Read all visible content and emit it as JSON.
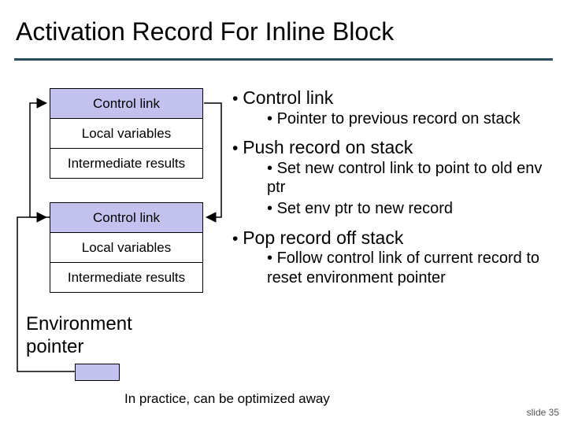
{
  "title": "Activation Record For Inline Block",
  "diagram": {
    "record1": {
      "control": "Control link",
      "locals": "Local variables",
      "inter": "Intermediate results"
    },
    "record2": {
      "control": "Control link",
      "locals": "Local variables",
      "inter": "Intermediate results"
    },
    "env_label_line1": "Environment",
    "env_label_line2": "pointer"
  },
  "bullets": {
    "b1": "Control link",
    "b1a": "Pointer to previous record on stack",
    "b2": "Push record on stack",
    "b2a": "Set new control link to point to old env ptr",
    "b2b": "Set env ptr to new record",
    "b3": "Pop record off stack",
    "b3a": "Follow control link of current record to reset environment pointer"
  },
  "bottom_note": "In practice, can be optimized away",
  "slide_number": "slide 35"
}
